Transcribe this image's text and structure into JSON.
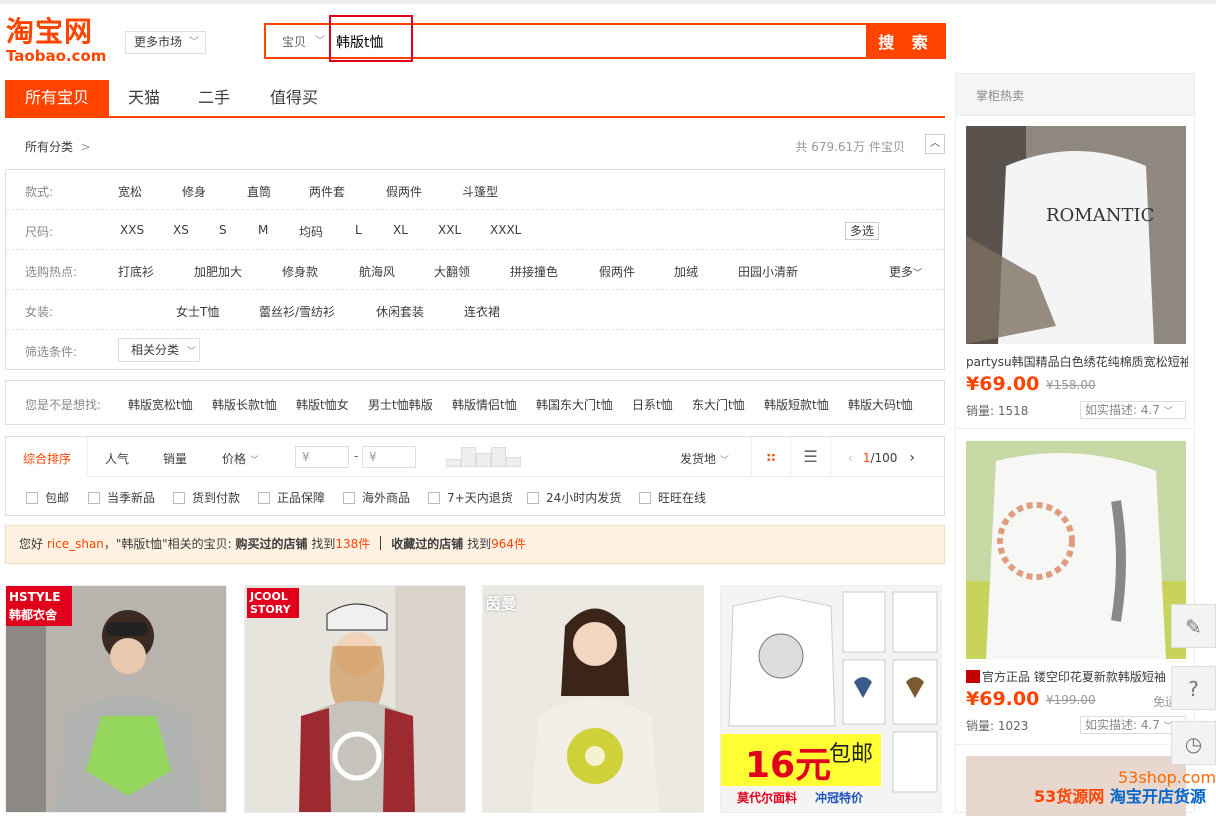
{
  "logo": {
    "cn": "淘宝网",
    "en": "Taobao.com"
  },
  "market_select": {
    "label": "更多市场"
  },
  "search": {
    "scope": "宝贝",
    "query": "韩版t恤",
    "button": "搜 索"
  },
  "tabs": [
    "所有宝贝",
    "天猫",
    "二手",
    "值得买"
  ],
  "category": {
    "label": "所有分类",
    "count": "共 679.61万 件宝贝"
  },
  "filters": {
    "style": {
      "label": "款式:",
      "items": [
        "宽松",
        "修身",
        "直筒",
        "两件套",
        "假两件",
        "斗篷型"
      ]
    },
    "size": {
      "label": "尺码:",
      "items": [
        "XXS",
        "XS",
        "S",
        "M",
        "均码",
        "L",
        "XL",
        "XXL",
        "XXXL"
      ],
      "multi": "多选"
    },
    "hot": {
      "label": "选购热点:",
      "items": [
        "打底衫",
        "加肥加大",
        "修身款",
        "航海风",
        "大翻领",
        "拼接撞色",
        "假两件",
        "加绒",
        "田园小清新"
      ],
      "more": "更多"
    },
    "women": {
      "label": "女装:",
      "items": [
        "女士T恤",
        "蕾丝衫/雪纺衫",
        "休闲套装",
        "连衣裙"
      ]
    },
    "cond": {
      "label": "筛选条件:",
      "select": "相关分类"
    }
  },
  "suggest": {
    "label": "您是不是想找:",
    "items": [
      "韩版宽松t恤",
      "韩版长款t恤",
      "韩版t恤女",
      "男士t恤韩版",
      "韩版情侣t恤",
      "韩国东大门t恤",
      "日系t恤",
      "东大门t恤",
      "韩版短款t恤",
      "韩版大码t恤"
    ]
  },
  "sort": {
    "items": [
      "综合排序",
      "人气",
      "销量",
      "价格"
    ],
    "price_placeholder": "¥",
    "ship": "发货地",
    "page": {
      "current": "1",
      "total": "/100"
    }
  },
  "checks": [
    "包邮",
    "当季新品",
    "货到付款",
    "正品保障",
    "海外商品",
    "7+天内退货",
    "24小时内发货",
    "旺旺在线"
  ],
  "notice": {
    "prefix": "您好 ",
    "user": "rice_shan",
    "mid": "，\"韩版t恤\"相关的宝贝:",
    "bought": "购买过的店铺",
    "found1": " 找到",
    "n1": "138件",
    "fav": "收藏过的店铺",
    "found2": " 找到",
    "n2": "964件"
  },
  "products": [
    {
      "badge": "HSTYLE\n韩都衣舍",
      "color": "#9a8f88"
    },
    {
      "badge": "JCOOL\nSTORY",
      "color": "#c8c8c0"
    },
    {
      "badge": "茵曼",
      "color": "#e9e8e2"
    },
    {
      "badge": "16元",
      "tag": "包邮",
      "line1": "莫代尔面料",
      "line2": "冲冠特价",
      "color": "#f4f4f4"
    }
  ],
  "right": {
    "title": "掌柜热卖",
    "items": [
      {
        "title": "partysu韩国精品白色绣花纯棉质宽松短袖",
        "price": "¥69.00",
        "old": "¥158.00",
        "sales": "销量: 1518",
        "desc": "如实描述: 4.7"
      },
      {
        "title": "官方正品 镂空印花夏新款韩版短袖",
        "price": "¥69.00",
        "old": "¥199.00",
        "ship": "免运",
        "sales": "销量: 1023",
        "desc": "如实描述: 4.7"
      }
    ]
  },
  "side": [
    "edit-icon",
    "help-icon",
    "history-icon"
  ],
  "watermark": {
    "url": "53shop.com",
    "brand": "53货源网",
    "slogan": "淘宝开店货源"
  },
  "colors": {
    "accent": "#ff4400",
    "notice_bg": "#fff2e2",
    "annotation": "#e0001b"
  }
}
